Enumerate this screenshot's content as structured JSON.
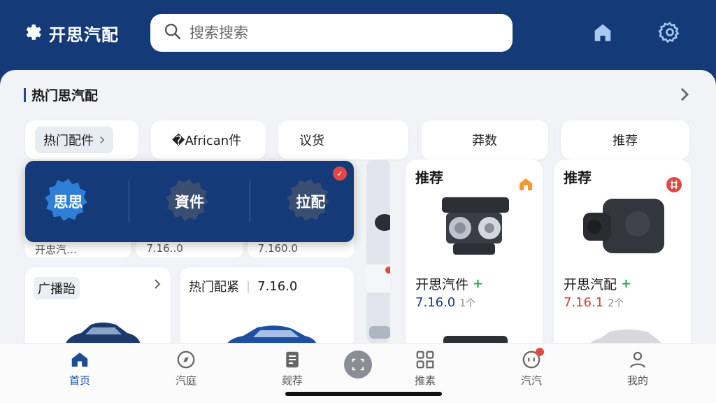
{
  "header": {
    "brand_name": "开思汽配",
    "search_placeholder": "搜索搜索"
  },
  "section": {
    "title": "热门思汽配"
  },
  "categories": [
    {
      "label": "热门配件"
    },
    {
      "label": "�African件"
    },
    {
      "label": "议货"
    },
    {
      "label": "莽数"
    },
    {
      "label": "推荐"
    }
  ],
  "overlay": {
    "items": [
      "思思",
      "資件",
      "拉配"
    ]
  },
  "peek": [
    "开忠汽…",
    "7.16..0",
    "7.160.0"
  ],
  "lower_cards": [
    {
      "title": "广播跆"
    },
    {
      "title": "热门配紧",
      "version": "7.16.0"
    }
  ],
  "products": [
    {
      "tag": "推荐",
      "name": "开思汽件",
      "version": "7.16.0",
      "count": "1个"
    },
    {
      "tag": "推荐",
      "name": "开思汽配",
      "version": "7.16.1",
      "count": "2个"
    }
  ],
  "colors": {
    "brand_blue": "#153a78",
    "accent_green": "#2ea44f",
    "badge_red": "#e04848",
    "version_red": "#d13b3b"
  },
  "bottom_nav": [
    {
      "label": "首页",
      "icon": "home-icon",
      "active": true
    },
    {
      "label": "汽庭",
      "icon": "compass-icon"
    },
    {
      "label": "觌荐",
      "icon": "document-icon"
    },
    {
      "label": "推素",
      "icon": "grid-icon"
    },
    {
      "label": "汽汽",
      "icon": "message-icon"
    },
    {
      "label": "我的",
      "icon": "person-icon"
    }
  ]
}
